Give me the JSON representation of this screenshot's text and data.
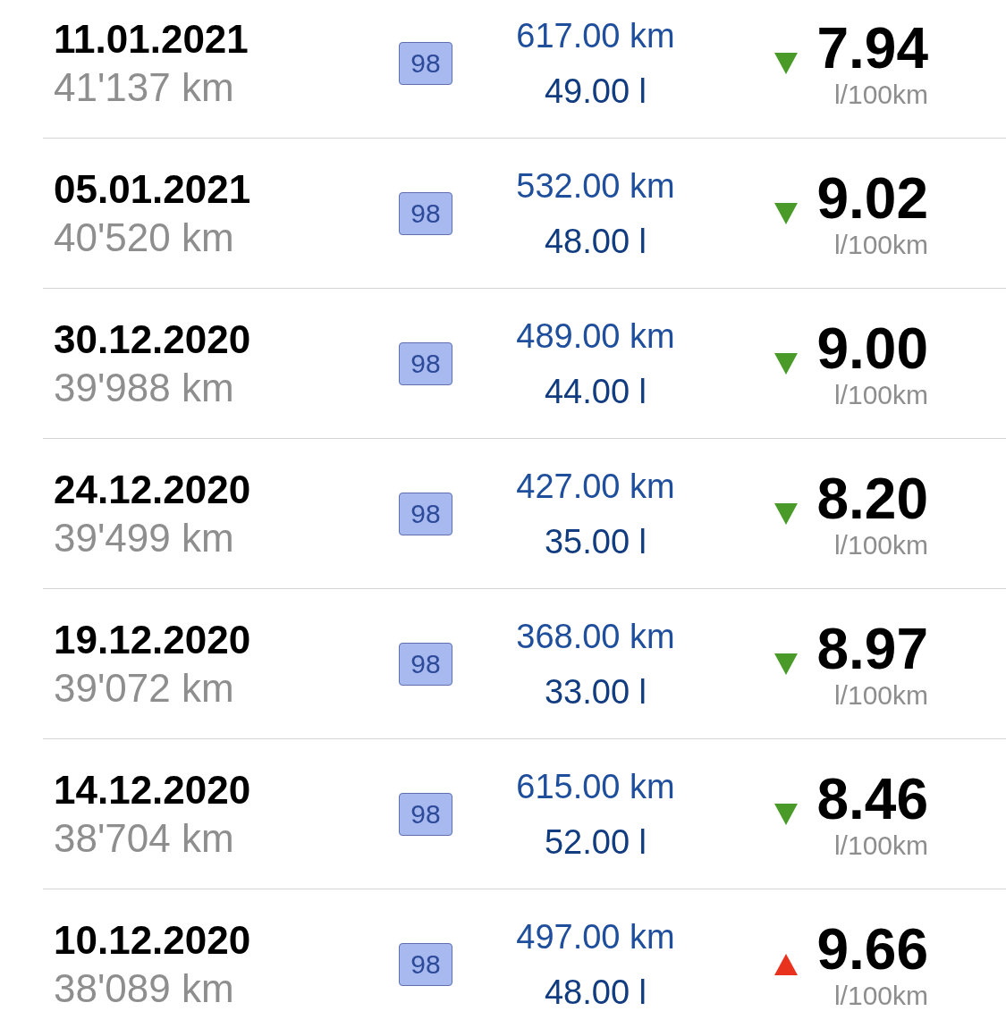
{
  "entries": [
    {
      "date": "11.01.2021",
      "odometer": "41'137 km",
      "fuel": "98",
      "distance": "617.00 km",
      "volume": "49.00 l",
      "increase": false,
      "consumption": "7.94",
      "unit": "l/100km"
    },
    {
      "date": "05.01.2021",
      "odometer": "40'520 km",
      "fuel": "98",
      "distance": "532.00 km",
      "volume": "48.00 l",
      "increase": false,
      "consumption": "9.02",
      "unit": "l/100km"
    },
    {
      "date": "30.12.2020",
      "odometer": "39'988 km",
      "fuel": "98",
      "distance": "489.00 km",
      "volume": "44.00 l",
      "increase": false,
      "consumption": "9.00",
      "unit": "l/100km"
    },
    {
      "date": "24.12.2020",
      "odometer": "39'499 km",
      "fuel": "98",
      "distance": "427.00 km",
      "volume": "35.00 l",
      "increase": false,
      "consumption": "8.20",
      "unit": "l/100km"
    },
    {
      "date": "19.12.2020",
      "odometer": "39'072 km",
      "fuel": "98",
      "distance": "368.00 km",
      "volume": "33.00 l",
      "increase": false,
      "consumption": "8.97",
      "unit": "l/100km"
    },
    {
      "date": "14.12.2020",
      "odometer": "38'704 km",
      "fuel": "98",
      "distance": "615.00 km",
      "volume": "52.00 l",
      "increase": false,
      "consumption": "8.46",
      "unit": "l/100km"
    },
    {
      "date": "10.12.2020",
      "odometer": "38'089 km",
      "fuel": "98",
      "distance": "497.00 km",
      "volume": "48.00 l",
      "increase": true,
      "consumption": "9.66",
      "unit": "l/100km"
    }
  ]
}
